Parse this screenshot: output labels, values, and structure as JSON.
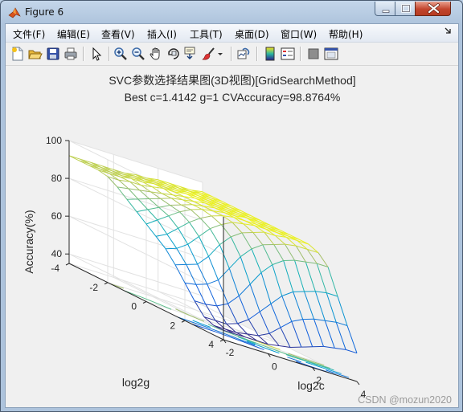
{
  "window": {
    "title": "Figure 6",
    "controls": [
      "minimize",
      "maximize",
      "close"
    ]
  },
  "menu": {
    "items": [
      {
        "label": "文件(F)"
      },
      {
        "label": "编辑(E)"
      },
      {
        "label": "查看(V)"
      },
      {
        "label": "插入(I)"
      },
      {
        "label": "工具(T)"
      },
      {
        "label": "桌面(D)"
      },
      {
        "label": "窗口(W)"
      },
      {
        "label": "帮助(H)"
      }
    ],
    "dock_icon": "dock-arrow-icon"
  },
  "toolbar": {
    "buttons": [
      {
        "icon": "new-figure-icon"
      },
      {
        "icon": "open-file-icon"
      },
      {
        "icon": "save-icon"
      },
      {
        "icon": "print-icon"
      },
      {
        "icon": "edit-plot-arrow-icon"
      },
      {
        "icon": "zoom-in-icon"
      },
      {
        "icon": "zoom-out-icon"
      },
      {
        "icon": "pan-hand-icon"
      },
      {
        "icon": "rotate-3d-icon"
      },
      {
        "icon": "data-cursor-icon"
      },
      {
        "icon": "brush-icon"
      },
      {
        "icon": "link-plot-icon"
      },
      {
        "icon": "colorbar-icon"
      },
      {
        "icon": "legend-icon"
      },
      {
        "icon": "hide-plot-tools-icon"
      },
      {
        "icon": "show-plot-tools-icon"
      }
    ]
  },
  "figure": {
    "title_line1": "SVC参数选择结果图(3D视图)[GridSearchMethod]",
    "title_line2": "Best c=1.4142 g=1 CVAccuracy=98.8764%",
    "xlabel": "log2c",
    "ylabel": "log2g",
    "zlabel": "Accuracy(%)",
    "watermark": "CSDN @mozun2020"
  },
  "chart_data": {
    "type": "surface-3d-mesh-with-contour",
    "title": "SVC参数选择结果图(3D视图)[GridSearchMethod]",
    "subtitle": "Best c=1.4142 g=1 CVAccuracy=98.8764%",
    "xlabel": "log2c",
    "ylabel": "log2g",
    "zlabel": "Accuracy(%)",
    "xlim": [
      -2,
      4
    ],
    "ylim": [
      -4,
      4
    ],
    "zlim": [
      35,
      100
    ],
    "x_ticks": [
      "-2",
      "0",
      "2",
      "4"
    ],
    "y_ticks": [
      "-4",
      "-2",
      "0",
      "2",
      "4"
    ],
    "z_ticks": [
      "40",
      "60",
      "80",
      "100"
    ],
    "grid": true,
    "x_step": 0.5,
    "y_step": 0.5,
    "x": [
      -2,
      -1.5,
      -1,
      -0.5,
      0,
      0.5,
      1,
      1.5,
      2,
      2.5,
      3,
      3.5,
      4
    ],
    "y": [
      -4,
      -3.5,
      -3,
      -2.5,
      -2,
      -1.5,
      -1,
      -0.5,
      0,
      0.5,
      1,
      1.5,
      2,
      2.5,
      3,
      3.5,
      4
    ],
    "z_rows_by_y": [
      [
        92,
        92,
        92,
        92,
        92,
        92,
        93,
        93,
        94,
        94,
        94,
        94,
        95
      ],
      [
        92,
        92,
        92,
        92,
        92,
        93,
        93,
        94,
        94,
        94,
        94,
        95,
        95
      ],
      [
        92,
        92,
        92,
        92,
        93,
        93,
        94,
        94,
        94,
        95,
        95,
        95,
        95
      ],
      [
        92,
        92,
        92,
        93,
        93,
        94,
        94,
        94,
        95,
        95,
        95,
        95,
        95
      ],
      [
        91,
        91,
        92,
        92,
        93,
        94,
        94,
        95,
        95,
        95,
        95,
        95,
        95
      ],
      [
        88,
        89,
        90,
        91,
        92,
        93,
        94,
        95,
        95,
        95,
        95,
        95,
        95
      ],
      [
        84,
        86,
        88,
        90,
        92,
        93,
        94,
        95,
        95,
        95,
        95,
        95,
        95
      ],
      [
        80,
        83,
        86,
        89,
        91,
        93,
        94,
        95,
        95,
        95,
        95,
        95,
        95
      ],
      [
        76,
        80,
        84,
        88,
        91,
        93,
        94,
        95,
        95,
        96,
        95,
        95,
        95
      ],
      [
        72,
        75,
        80,
        85,
        89,
        92,
        94,
        95,
        95,
        95,
        95,
        95,
        95
      ],
      [
        68,
        70,
        74,
        80,
        86,
        90,
        93,
        94,
        95,
        95,
        95,
        95,
        95
      ],
      [
        62,
        64,
        66,
        72,
        80,
        86,
        90,
        92,
        94,
        94,
        95,
        95,
        95
      ],
      [
        55,
        56,
        58,
        62,
        70,
        78,
        84,
        88,
        90,
        92,
        93,
        93,
        93
      ],
      [
        48,
        48,
        49,
        52,
        58,
        66,
        74,
        80,
        84,
        86,
        87,
        88,
        88
      ],
      [
        42,
        42,
        42,
        44,
        48,
        54,
        60,
        66,
        70,
        72,
        74,
        75,
        75
      ],
      [
        40,
        40,
        40,
        41,
        42,
        45,
        50,
        55,
        58,
        60,
        61,
        62,
        62
      ],
      [
        40,
        40,
        40,
        40,
        40,
        41,
        42,
        44,
        46,
        48,
        49,
        50,
        50
      ]
    ]
  },
  "colors": {
    "surface_high": "#f9e21c",
    "surface_mid": "#2ab5a0",
    "surface_low": "#2b1e8c",
    "axis": "#262626",
    "grid": "#e2e2e2"
  }
}
